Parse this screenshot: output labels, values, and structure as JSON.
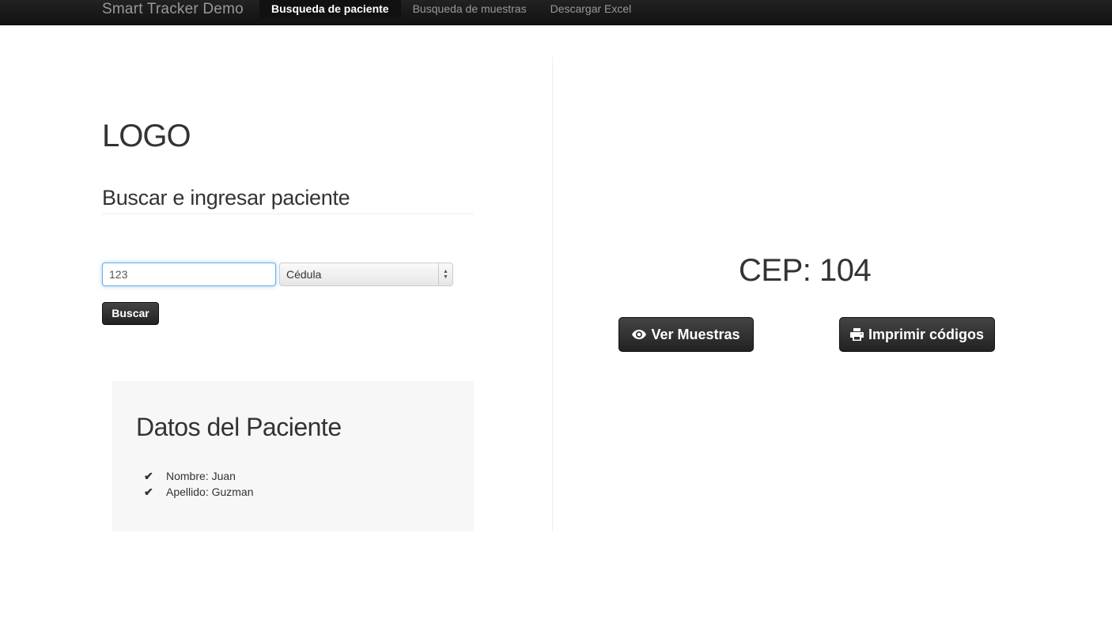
{
  "navbar": {
    "brand": "Smart Tracker Demo",
    "items": [
      {
        "label": "Busqueda de paciente",
        "active": true
      },
      {
        "label": "Busqueda de muestras",
        "active": false
      },
      {
        "label": "Descargar Excel",
        "active": false
      }
    ]
  },
  "left": {
    "logo": "LOGO",
    "section_title": "Buscar e ingresar paciente",
    "search": {
      "value": "123",
      "placeholder": ""
    },
    "select": {
      "selected": "Cédula"
    },
    "search_button": "Buscar",
    "patient_card": {
      "title": "Datos del Paciente",
      "items": [
        "Nombre: Juan",
        "Apellido: Guzman"
      ]
    }
  },
  "right": {
    "cep": "CEP: 104",
    "ver_muestras": "Ver Muestras",
    "imprimir_codigos": "Imprimir códigos"
  },
  "colors": {
    "navbar_bg": "#1b1b1b",
    "button_bg": "#333333",
    "input_focus": "#66afe9",
    "card_bg": "#f7f7f7"
  },
  "icons": [
    "check-icon",
    "eye-icon",
    "print-icon",
    "select-arrows-icon"
  ]
}
